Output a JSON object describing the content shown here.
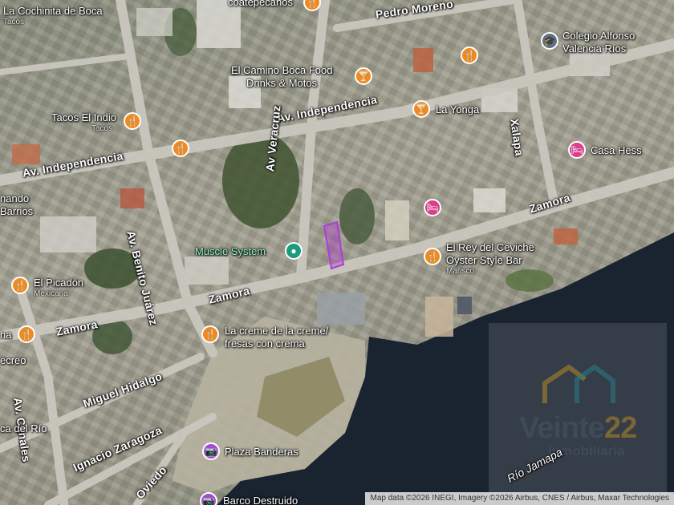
{
  "map": {
    "colors": {
      "water": "#1a2330",
      "road": "#c9c7be",
      "food_pin": "#f08a1e",
      "hotel_pin": "#d8418b",
      "gym_pin": "#1c9a7e",
      "photo_pin": "#a34bd0",
      "edu_pin": "#5f6f85"
    },
    "roads": {
      "independencia_top": "Av. Independencia",
      "independencia_left": "Av. Independencia",
      "veracruz": "Av Veracruz",
      "benito_juarez": "Av. Benito Juárez",
      "xalapa": "Xalapa",
      "zamora_right": "Zamora",
      "zamora_mid": "Zamora",
      "zamora_left": "Zamora",
      "canales": "Av. Canales",
      "hidalgo": "Miguel Hidalgo",
      "zaragoza": "Ignacio Zaragoza",
      "oviedo": "Oviedo",
      "pedro_moreno": "Pedro Moreno"
    },
    "places": {
      "cochinita": "La Cochinita de Boca",
      "cochinita_sub": "Tacos",
      "coatepecanos": "coatepecanos",
      "colegio_line1": "Colegio Alfonso",
      "colegio_line2": "Valencia Ríos",
      "camino_line1": "El Camino Boca Food",
      "camino_line2": "Drinks & Motos",
      "la_yonga": "La Yonga",
      "tacos_indio": "Tacos El Indio",
      "tacos_indio_sub": "Tacos",
      "casa_hess": "Casa Hess",
      "nando_line1": "nando",
      "nando_line2": "Barrios",
      "muscle": "Muscle System",
      "rey_line1": "El Rey del Ceviche",
      "rey_line2": "Oyster Style Bar",
      "rey_sub": "Marisco",
      "picadon": "El Picadón",
      "picadon_sub": "Mexicana",
      "creme_line1": "La creme de la creme/",
      "creme_line2": "fresas con crema",
      "na": "na",
      "recreo": "ecreo",
      "cadelrio": "ca del Río",
      "plaza": "Plaza Banderas",
      "barco": "Barco Destruido"
    },
    "water_label": "Río Jamapa",
    "watermark": {
      "name_a": "Veinte",
      "name_b": "22",
      "sub": "Inmobiliaria"
    },
    "attribution": "Map data ©2026 INEGI, Imagery ©2026 Airbus, CNES / Airbus, Maxar Technologies"
  }
}
